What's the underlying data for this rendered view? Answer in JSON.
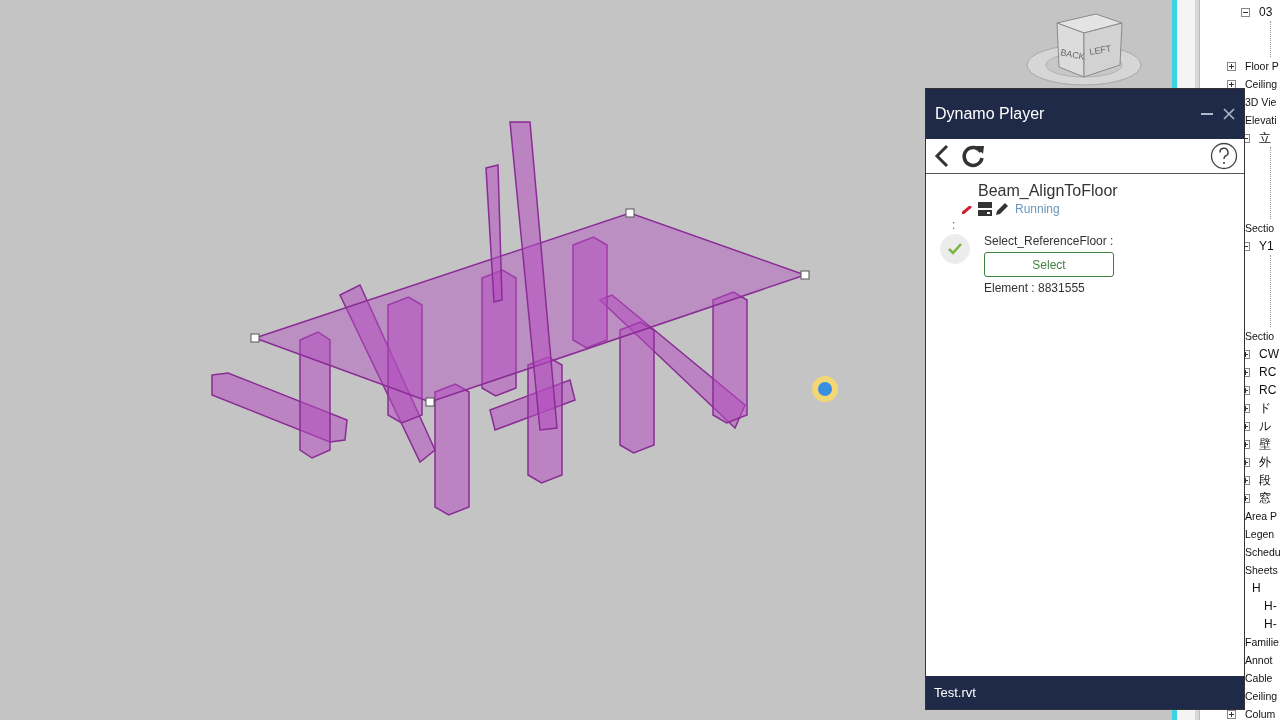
{
  "view_cube": {
    "back": "BACK",
    "left": "LEFT"
  },
  "dynamo_player": {
    "title": "Dynamo Player",
    "script": {
      "name": "Beam_AlignToFloor",
      "status": "Running"
    },
    "separator": ":",
    "inputs": [
      {
        "label": "Select_ReferenceFloor :",
        "done": true,
        "button": "Select",
        "value": "Element : 8831555"
      }
    ],
    "footer": "Test.rvt"
  },
  "project_browser": {
    "items": [
      {
        "children": [
          {
            "label": "03",
            "expanded": true
          }
        ]
      },
      {
        "label": "Floor P",
        "expanded": false
      },
      {
        "label": "Ceiling",
        "expanded": false
      },
      {
        "label": "3D Vie"
      },
      {
        "label": "Elevati",
        "children": [
          {
            "label": "立",
            "expanded": true
          }
        ]
      },
      {
        "label": "Sectio",
        "children": [
          {
            "label": "Y1",
            "expanded": true
          }
        ]
      },
      {
        "label": "Sectio",
        "children": [
          {
            "label": "CW",
            "expanded": false
          },
          {
            "label": "RC",
            "expanded": false
          },
          {
            "label": "RC",
            "expanded": false
          },
          {
            "label": "ド",
            "expanded": false
          },
          {
            "label": "ル",
            "expanded": false
          },
          {
            "label": "壁",
            "expanded": false
          },
          {
            "label": "外",
            "expanded": false
          },
          {
            "label": "段",
            "expanded": false
          },
          {
            "label": "窓",
            "expanded": false
          }
        ]
      },
      {
        "label": "Area P"
      },
      {
        "label": "Legen"
      },
      {
        "label": "Schedu"
      },
      {
        "label": "Sheets",
        "children": [
          {
            "label": "H",
            "children": [
              {
                "label": "H-"
              },
              {
                "label": "H-"
              }
            ]
          }
        ]
      },
      {
        "label": "Familie"
      },
      {
        "label": "Annot"
      },
      {
        "label": "Cable"
      },
      {
        "label": "Ceiling"
      },
      {
        "label": "Colum",
        "expanded": false
      }
    ]
  }
}
